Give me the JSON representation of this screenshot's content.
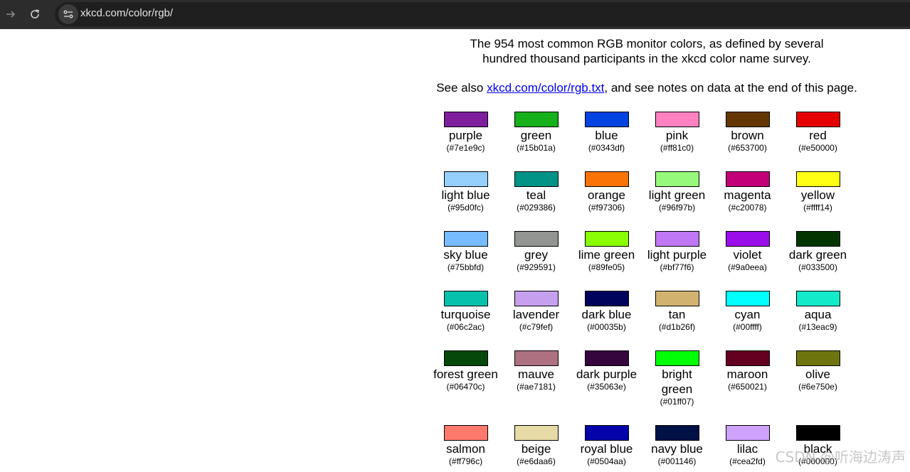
{
  "browser": {
    "url": "xkcd.com/color/rgb/",
    "icons": {
      "forward": "forward-arrow-icon",
      "reload": "reload-icon",
      "site_info": "site-info-icon"
    }
  },
  "page": {
    "intro_line1": "The 954 most common RGB monitor colors, as defined by several",
    "intro_line2": "hundred thousand participants in the xkcd color name survey.",
    "see_also_prefix": "See also ",
    "see_also_link": "xkcd.com/color/rgb.txt",
    "see_also_suffix": ", and see notes on data at the end of this page."
  },
  "colors": [
    {
      "name": "purple",
      "hex": "(#7e1e9c)",
      "color": "#7e1e9c"
    },
    {
      "name": "green",
      "hex": "(#15b01a)",
      "color": "#15b01a"
    },
    {
      "name": "blue",
      "hex": "(#0343df)",
      "color": "#0343df"
    },
    {
      "name": "pink",
      "hex": "(#ff81c0)",
      "color": "#ff81c0"
    },
    {
      "name": "brown",
      "hex": "(#653700)",
      "color": "#653700"
    },
    {
      "name": "red",
      "hex": "(#e50000)",
      "color": "#e50000"
    },
    {
      "name": "light blue",
      "hex": "(#95d0fc)",
      "color": "#95d0fc"
    },
    {
      "name": "teal",
      "hex": "(#029386)",
      "color": "#029386"
    },
    {
      "name": "orange",
      "hex": "(#f97306)",
      "color": "#f97306"
    },
    {
      "name": "light green",
      "hex": "(#96f97b)",
      "color": "#96f97b"
    },
    {
      "name": "magenta",
      "hex": "(#c20078)",
      "color": "#c20078"
    },
    {
      "name": "yellow",
      "hex": "(#ffff14)",
      "color": "#ffff14"
    },
    {
      "name": "sky blue",
      "hex": "(#75bbfd)",
      "color": "#75bbfd"
    },
    {
      "name": "grey",
      "hex": "(#929591)",
      "color": "#929591"
    },
    {
      "name": "lime green",
      "hex": "(#89fe05)",
      "color": "#89fe05"
    },
    {
      "name": "light purple",
      "hex": "(#bf77f6)",
      "color": "#bf77f6"
    },
    {
      "name": "violet",
      "hex": "(#9a0eea)",
      "color": "#9a0eea"
    },
    {
      "name": "dark green",
      "hex": "(#033500)",
      "color": "#033500"
    },
    {
      "name": "turquoise",
      "hex": "(#06c2ac)",
      "color": "#06c2ac"
    },
    {
      "name": "lavender",
      "hex": "(#c79fef)",
      "color": "#c79fef"
    },
    {
      "name": "dark blue",
      "hex": "(#00035b)",
      "color": "#00035b"
    },
    {
      "name": "tan",
      "hex": "(#d1b26f)",
      "color": "#d1b26f"
    },
    {
      "name": "cyan",
      "hex": "(#00ffff)",
      "color": "#00ffff"
    },
    {
      "name": "aqua",
      "hex": "(#13eac9)",
      "color": "#13eac9"
    },
    {
      "name": "forest green",
      "hex": "(#06470c)",
      "color": "#06470c"
    },
    {
      "name": "mauve",
      "hex": "(#ae7181)",
      "color": "#ae7181"
    },
    {
      "name": "dark purple",
      "hex": "(#35063e)",
      "color": "#35063e"
    },
    {
      "name": "bright green",
      "hex": "(#01ff07)",
      "color": "#01ff07"
    },
    {
      "name": "maroon",
      "hex": "(#650021)",
      "color": "#650021"
    },
    {
      "name": "olive",
      "hex": "(#6e750e)",
      "color": "#6e750e"
    },
    {
      "name": "salmon",
      "hex": "(#ff796c)",
      "color": "#ff796c"
    },
    {
      "name": "beige",
      "hex": "(#e6daa6)",
      "color": "#e6daa6"
    },
    {
      "name": "royal blue",
      "hex": "(#0504aa)",
      "color": "#0504aa"
    },
    {
      "name": "navy blue",
      "hex": "(#001146)",
      "color": "#001146"
    },
    {
      "name": "lilac",
      "hex": "(#cea2fd)",
      "color": "#cea2fd"
    },
    {
      "name": "black",
      "hex": "(#000000)",
      "color": "#000000"
    }
  ],
  "watermark": "CSDN @听海边涛声"
}
